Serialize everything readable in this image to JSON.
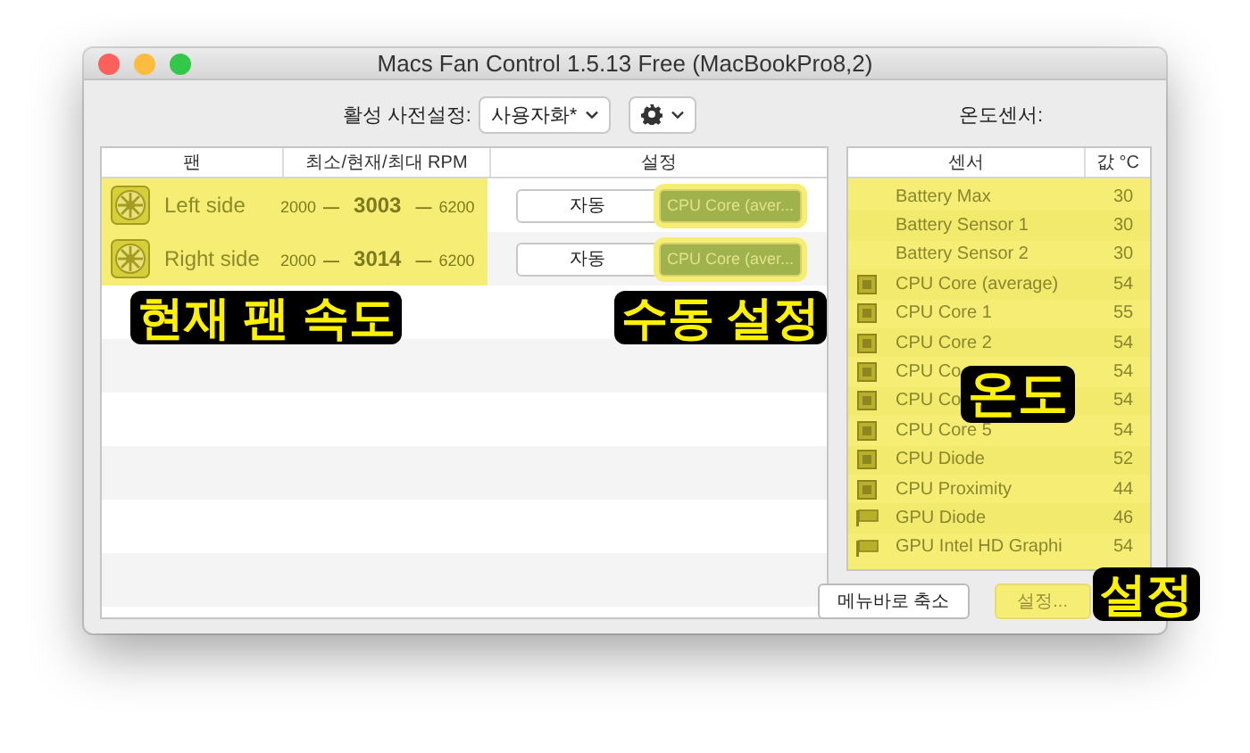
{
  "window": {
    "title": "Macs Fan Control 1.5.13 Free (MacBookPro8,2)"
  },
  "toolbar": {
    "preset_label": "활성 사전설정:",
    "preset_value": "사용자화*",
    "sensors_label": "온도센서:"
  },
  "fan_table": {
    "columns": [
      "팬",
      "최소/현재/최대 RPM",
      "설정"
    ],
    "rows": [
      {
        "name": "Left side",
        "min": "2000",
        "current": "3003",
        "max": "6200",
        "separator": "—",
        "modes": [
          {
            "label": "자동",
            "selected": false
          },
          {
            "label": "CPU Core (aver...",
            "selected": true
          }
        ]
      },
      {
        "name": "Right side",
        "min": "2000",
        "current": "3014",
        "max": "6200",
        "separator": "—",
        "modes": [
          {
            "label": "자동",
            "selected": false
          },
          {
            "label": "CPU Core (aver...",
            "selected": true
          }
        ]
      }
    ]
  },
  "sensor_table": {
    "columns": [
      "센서",
      "값 °C"
    ],
    "rows": [
      {
        "kind": "battery",
        "name": "Battery Max",
        "value": "30"
      },
      {
        "kind": "battery",
        "name": "Battery Sensor 1",
        "value": "30"
      },
      {
        "kind": "battery",
        "name": "Battery Sensor 2",
        "value": "30"
      },
      {
        "kind": "cpu",
        "name": "CPU Core (average)",
        "value": "54"
      },
      {
        "kind": "cpu",
        "name": "CPU Core 1",
        "value": "55"
      },
      {
        "kind": "cpu",
        "name": "CPU Core 2",
        "value": "54"
      },
      {
        "kind": "cpu",
        "name": "CPU Co",
        "value": "54"
      },
      {
        "kind": "cpu",
        "name": "CPU Co",
        "value": "54"
      },
      {
        "kind": "cpu",
        "name": "CPU Core 5",
        "value": "54"
      },
      {
        "kind": "cpu",
        "name": "CPU Diode",
        "value": "52"
      },
      {
        "kind": "cpu",
        "name": "CPU Proximity",
        "value": "44"
      },
      {
        "kind": "gpu",
        "name": "GPU Diode",
        "value": "46"
      },
      {
        "kind": "gpu",
        "name": "GPU Intel HD Graphi",
        "value": "54"
      }
    ]
  },
  "buttons": [
    "메뉴바로 축소",
    "설정..."
  ],
  "annotations": [
    "현재 팬 속도",
    "수동 설정",
    "온도",
    "설정"
  ]
}
